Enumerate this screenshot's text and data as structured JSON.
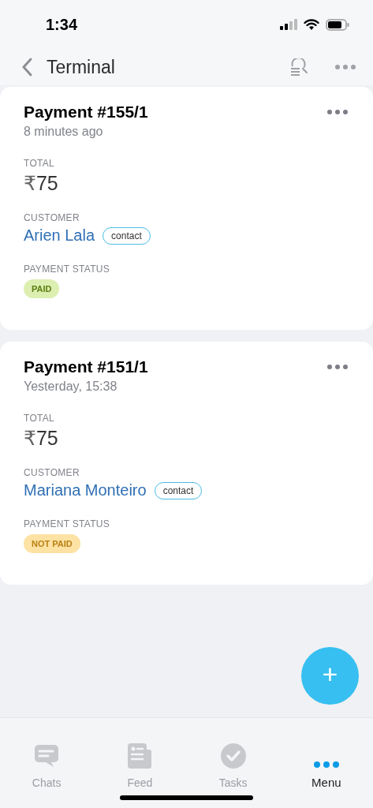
{
  "status_bar": {
    "time": "1:34"
  },
  "nav": {
    "title": "Terminal"
  },
  "payments": [
    {
      "title": "Payment #155/1",
      "time": "8 minutes ago",
      "total_label": "TOTAL",
      "currency": "₹",
      "amount": "75",
      "customer_label": "CUSTOMER",
      "customer": "Arien Lala",
      "customer_tag": "contact",
      "status_label": "PAYMENT STATUS",
      "status": "PAID",
      "kind": "paid"
    },
    {
      "title": "Payment #151/1",
      "time": "Yesterday, 15:38",
      "total_label": "TOTAL",
      "currency": "₹",
      "amount": "75",
      "customer_label": "CUSTOMER",
      "customer": "Mariana Monteiro",
      "customer_tag": "contact",
      "status_label": "PAYMENT STATUS",
      "status": "NOT PAID",
      "kind": "not_paid"
    }
  ],
  "fab": {
    "label": "+"
  },
  "tabs": [
    {
      "label": "Chats",
      "kind": "chats",
      "selected": false
    },
    {
      "label": "Feed",
      "kind": "feed",
      "selected": false
    },
    {
      "label": "Tasks",
      "kind": "tasks",
      "selected": false
    },
    {
      "label": "Menu",
      "kind": "menu",
      "selected": true
    }
  ]
}
